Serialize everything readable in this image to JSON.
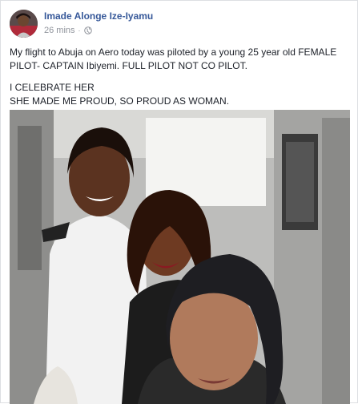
{
  "post": {
    "author_name": "Imade Alonge Ize-Iyamu",
    "time_ago": "26 mins",
    "separator": "·",
    "privacy_icon": "globe-icon",
    "lines": [
      "My flight to Abuja on Aero today was piloted by a young 25 year old FEMALE PILOT- CAPTAIN Ibiyemi. FULL PILOT NOT CO PILOT.",
      "I CELEBRATE HER",
      "SHE MADE ME PROUD, SO PROUD AS WOMAN."
    ],
    "photo_icon": "cockpit-selfie-photo"
  },
  "colors": {
    "author": "#365899",
    "meta": "#90949c",
    "text": "#1d2129"
  }
}
